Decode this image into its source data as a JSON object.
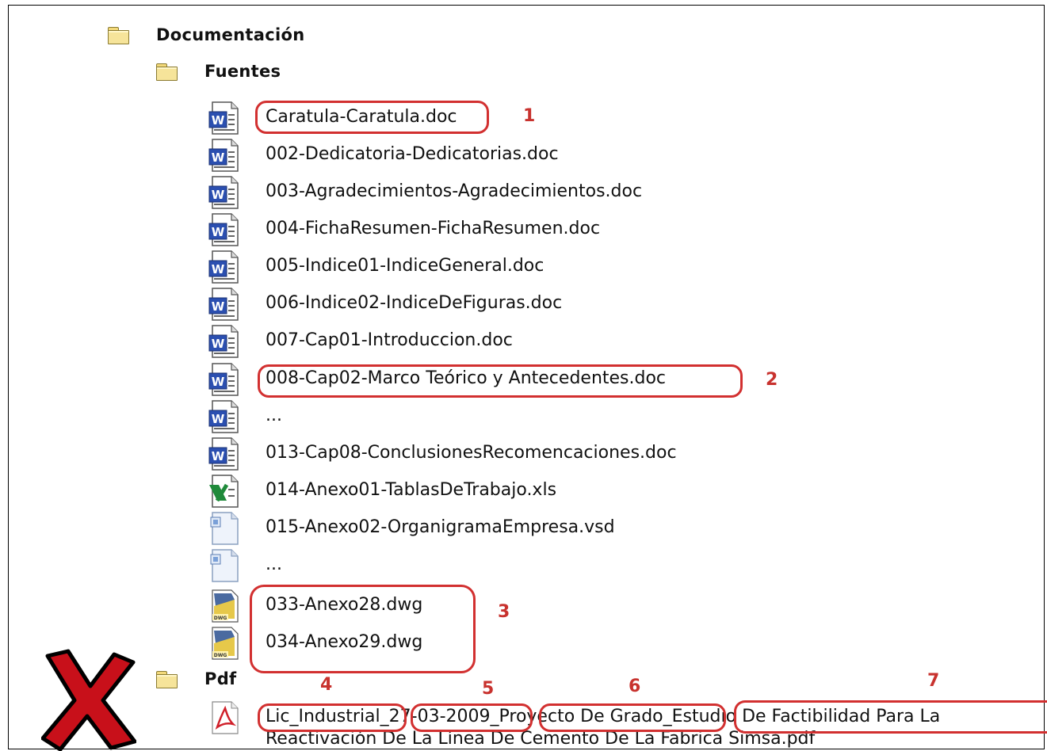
{
  "tree": {
    "root_folder": {
      "label": "Documentación",
      "icon": "folder-icon"
    },
    "sub_folder": {
      "label": "Fuentes",
      "icon": "folder-icon"
    },
    "files": [
      {
        "name": "Caratula-Caratula.doc",
        "icon": "word-doc-icon"
      },
      {
        "name": "002-Dedicatoria-Dedicatorias.doc",
        "icon": "word-doc-icon"
      },
      {
        "name": "003-Agradecimientos-Agradecimientos.doc",
        "icon": "word-doc-icon"
      },
      {
        "name": "004-FichaResumen-FichaResumen.doc",
        "icon": "word-doc-icon"
      },
      {
        "name": "005-Indice01-IndiceGeneral.doc",
        "icon": "word-doc-icon"
      },
      {
        "name": "006-Indice02-IndiceDeFiguras.doc",
        "icon": "word-doc-icon"
      },
      {
        "name": "007-Cap01-Introduccion.doc",
        "icon": "word-doc-icon"
      },
      {
        "name": "008-Cap02-Marco Teórico y Antecedentes.doc",
        "icon": "word-doc-icon"
      },
      {
        "name": "...",
        "icon": "word-doc-icon"
      },
      {
        "name": "013-Cap08-ConclusionesRecomencaciones.doc",
        "icon": "word-doc-icon"
      },
      {
        "name": "014-Anexo01-TablasDeTrabajo.xls",
        "icon": "excel-sheet-icon"
      },
      {
        "name": "015-Anexo02-OrganigramaEmpresa.vsd",
        "icon": "visio-diagram-icon"
      },
      {
        "name": "...",
        "icon": "visio-diagram-icon"
      },
      {
        "name": "033-Anexo28.dwg",
        "icon": "dwg-drawing-icon"
      },
      {
        "name": "034-Anexo29.dwg",
        "icon": "dwg-drawing-icon"
      }
    ],
    "pdf_folder": {
      "label": "Pdf",
      "icon": "folder-icon"
    },
    "pdf_file": {
      "line1_parts": [
        "Lic_Industrial",
        "_",
        "27-03-2009",
        "_",
        "Proyecto De Grado",
        "_",
        "Estudio De Factibilidad Para La"
      ],
      "line2": "Reactivación De La Línea De Cemento De La Fabrica Simsa.pdf",
      "icon": "pdf-document-icon"
    }
  },
  "annotations": {
    "numbers": [
      "1",
      "2",
      "3",
      "4",
      "5",
      "6",
      "7"
    ],
    "highlight_color": "#d23030",
    "cross_icon": "red-x-cross-icon"
  }
}
